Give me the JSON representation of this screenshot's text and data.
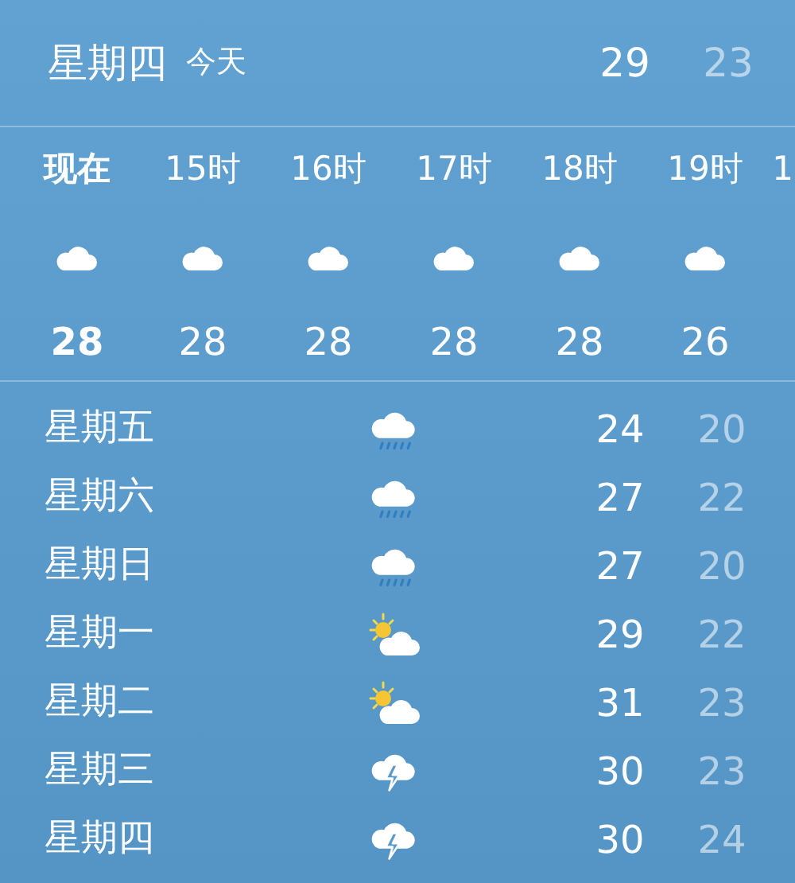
{
  "today": {
    "day": "星期四",
    "label": "今天",
    "high": "29",
    "low": "23"
  },
  "hourly": [
    {
      "time": "现在",
      "kind": "cloud",
      "temp": "28",
      "selected": true
    },
    {
      "time": "15时",
      "kind": "cloud",
      "temp": "28",
      "selected": false
    },
    {
      "time": "16时",
      "kind": "cloud",
      "temp": "28",
      "selected": false
    },
    {
      "time": "17时",
      "kind": "cloud",
      "temp": "28",
      "selected": false
    },
    {
      "time": "18时",
      "kind": "cloud",
      "temp": "28",
      "selected": false
    },
    {
      "time": "19时",
      "kind": "cloud",
      "temp": "26",
      "selected": false
    },
    {
      "time": "1",
      "selected": false
    }
  ],
  "daily": [
    {
      "day": "星期五",
      "kind": "rain",
      "high": "24",
      "low": "20"
    },
    {
      "day": "星期六",
      "kind": "rain",
      "high": "27",
      "low": "22"
    },
    {
      "day": "星期日",
      "kind": "rain",
      "high": "27",
      "low": "20"
    },
    {
      "day": "星期一",
      "kind": "partly_sunny",
      "high": "29",
      "low": "22"
    },
    {
      "day": "星期二",
      "kind": "partly_sunny",
      "high": "31",
      "low": "23"
    },
    {
      "day": "星期三",
      "kind": "thunder",
      "high": "30",
      "low": "23"
    },
    {
      "day": "星期四",
      "kind": "thunder",
      "high": "30",
      "low": "24"
    }
  ]
}
